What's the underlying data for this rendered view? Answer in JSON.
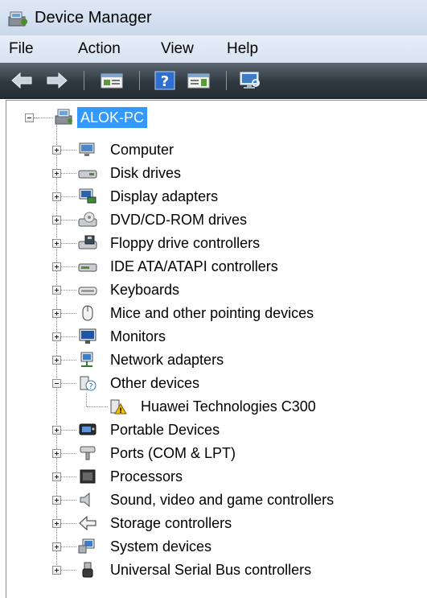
{
  "window": {
    "title": "Device Manager"
  },
  "menu": [
    "File",
    "Action",
    "View",
    "Help"
  ],
  "toolbar": {
    "buttons": [
      "back-icon",
      "forward-icon",
      "properties-icon",
      "help-icon",
      "update-driver-icon",
      "scan-hardware-icon"
    ]
  },
  "tree": {
    "root": "ALOK-PC",
    "categories": [
      {
        "label": "Computer",
        "icon": "computer-icon"
      },
      {
        "label": "Disk drives",
        "icon": "disk-drive-icon"
      },
      {
        "label": "Display adapters",
        "icon": "display-adapter-icon"
      },
      {
        "label": "DVD/CD-ROM drives",
        "icon": "dvd-drive-icon"
      },
      {
        "label": "Floppy drive controllers",
        "icon": "floppy-controller-icon"
      },
      {
        "label": "IDE ATA/ATAPI controllers",
        "icon": "ide-controller-icon"
      },
      {
        "label": "Keyboards",
        "icon": "keyboard-icon"
      },
      {
        "label": "Mice and other pointing devices",
        "icon": "mouse-icon"
      },
      {
        "label": "Monitors",
        "icon": "monitor-icon"
      },
      {
        "label": "Network adapters",
        "icon": "network-adapter-icon"
      },
      {
        "label": "Other devices",
        "icon": "unknown-device-icon",
        "expanded": true,
        "children": [
          {
            "label": "Huawei Technologies C300",
            "icon": "warning-device-icon"
          }
        ]
      },
      {
        "label": "Portable Devices",
        "icon": "portable-device-icon"
      },
      {
        "label": "Ports (COM & LPT)",
        "icon": "port-icon"
      },
      {
        "label": "Processors",
        "icon": "processor-icon"
      },
      {
        "label": "Sound, video and game controllers",
        "icon": "sound-icon"
      },
      {
        "label": "Storage controllers",
        "icon": "storage-controller-icon"
      },
      {
        "label": "System devices",
        "icon": "system-devices-icon"
      },
      {
        "label": "Universal Serial Bus controllers",
        "icon": "usb-icon"
      }
    ]
  }
}
